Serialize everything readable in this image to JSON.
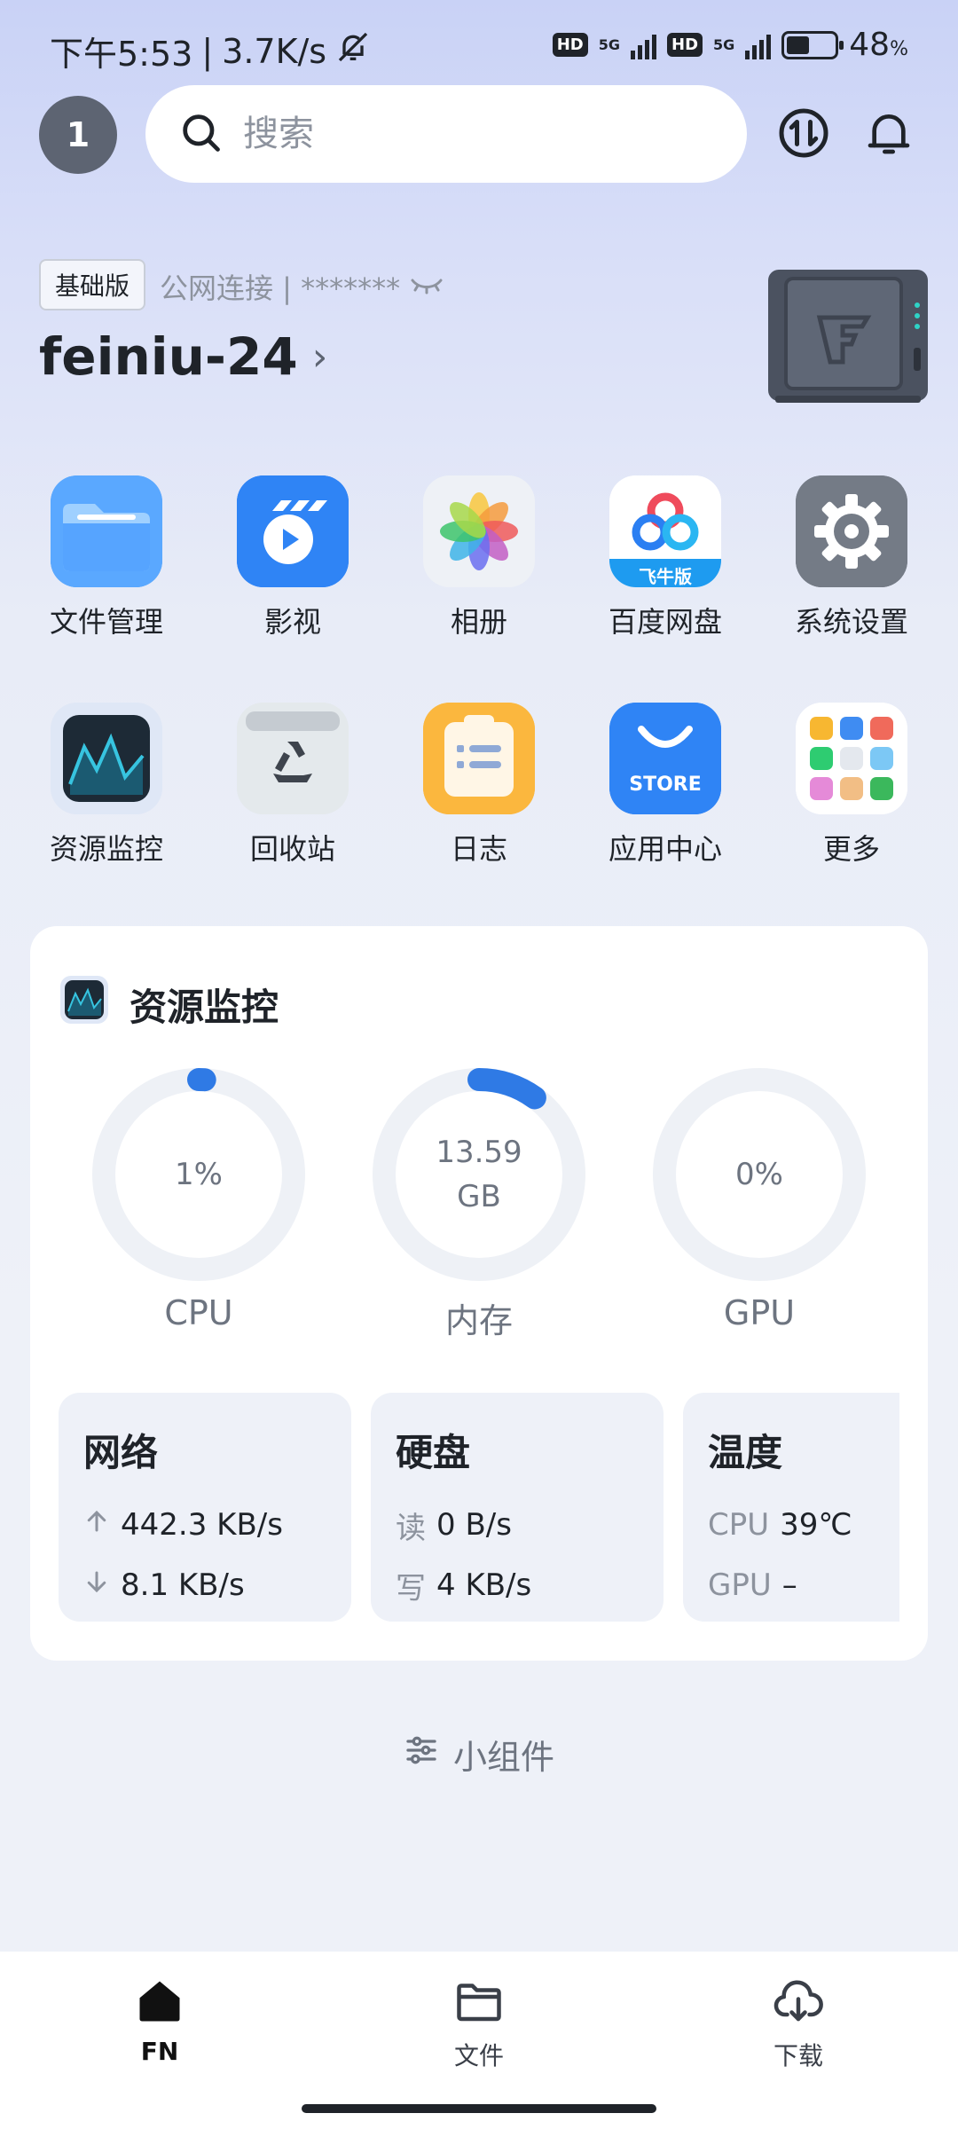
{
  "status_bar": {
    "time": "下午5:53",
    "speed": "3.7K/s",
    "network1": "5G",
    "network2": "5G",
    "hd": "HD",
    "battery_percent": "48",
    "battery_unit": "%",
    "battery_level": 0.48
  },
  "header": {
    "avatar_text": "1",
    "search_placeholder": "搜索"
  },
  "device": {
    "edition": "基础版",
    "connection": "公网连接 | *******",
    "name": "feiniu-24"
  },
  "apps": [
    {
      "label": "文件管理",
      "icon": "folder-icon"
    },
    {
      "label": "影视",
      "icon": "video-icon"
    },
    {
      "label": "相册",
      "icon": "photos-icon"
    },
    {
      "label": "百度网盘",
      "icon": "baidu-netdisk-icon",
      "badge": "飞牛版"
    },
    {
      "label": "系统设置",
      "icon": "gear-icon"
    },
    {
      "label": "资源监控",
      "icon": "monitor-icon"
    },
    {
      "label": "回收站",
      "icon": "recycle-bin-icon"
    },
    {
      "label": "日志",
      "icon": "log-icon"
    },
    {
      "label": "应用中心",
      "icon": "store-icon",
      "badge": "STORE"
    },
    {
      "label": "更多",
      "icon": "more-icon"
    }
  ],
  "monitor": {
    "title": "资源监控",
    "gauges": [
      {
        "label": "CPU",
        "value": "1%",
        "value2": "",
        "fraction": 0.01
      },
      {
        "label": "内存",
        "value": "13.59",
        "value2": "GB",
        "fraction": 0.1
      },
      {
        "label": "GPU",
        "value": "0%",
        "value2": "",
        "fraction": 0
      }
    ],
    "network": {
      "title": "网络",
      "up": "442.3 KB/s",
      "down": "8.1 KB/s"
    },
    "disk": {
      "title": "硬盘",
      "read_key": "读",
      "read": "0 B/s",
      "write_key": "写",
      "write": "4 KB/s"
    },
    "temp": {
      "title": "温度",
      "cpu_key": "CPU",
      "cpu": "39℃",
      "gpu_key": "GPU",
      "gpu": "–"
    }
  },
  "widget_link": "小组件",
  "bottom_nav": [
    {
      "label": "FN",
      "icon": "home-icon",
      "active": true
    },
    {
      "label": "文件",
      "icon": "folder-outline-icon",
      "active": false
    },
    {
      "label": "下载",
      "icon": "cloud-download-icon",
      "active": false
    }
  ],
  "colors": {
    "accent": "#2f7ae5",
    "track": "#eef1f6"
  }
}
